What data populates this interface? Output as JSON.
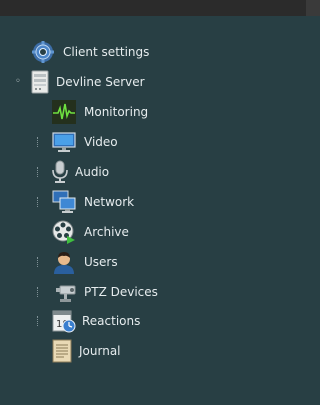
{
  "tree": {
    "client_settings": {
      "label": "Client settings",
      "icon": "gear-icon"
    },
    "server": {
      "label": "Devline Server",
      "icon": "server-icon",
      "expanded": true
    },
    "children": [
      {
        "label": "Monitoring",
        "icon": "pulse-monitor-icon",
        "expandable": false
      },
      {
        "label": "Video",
        "icon": "display-icon",
        "expandable": true
      },
      {
        "label": "Audio",
        "icon": "microphone-icon",
        "expandable": true
      },
      {
        "label": "Network",
        "icon": "network-icon",
        "expandable": true
      },
      {
        "label": "Archive",
        "icon": "film-reel-icon",
        "expandable": false
      },
      {
        "label": "Users",
        "icon": "user-icon",
        "expandable": true
      },
      {
        "label": "PTZ Devices",
        "icon": "ptz-camera-icon",
        "expandable": true
      },
      {
        "label": "Reactions",
        "icon": "calendar-clock-icon",
        "expandable": true
      },
      {
        "label": "Journal",
        "icon": "document-icon",
        "expandable": false
      }
    ]
  },
  "colors": {
    "background": "#283f44",
    "text": "#e6ecee",
    "topbar": "#2b2b2b"
  }
}
